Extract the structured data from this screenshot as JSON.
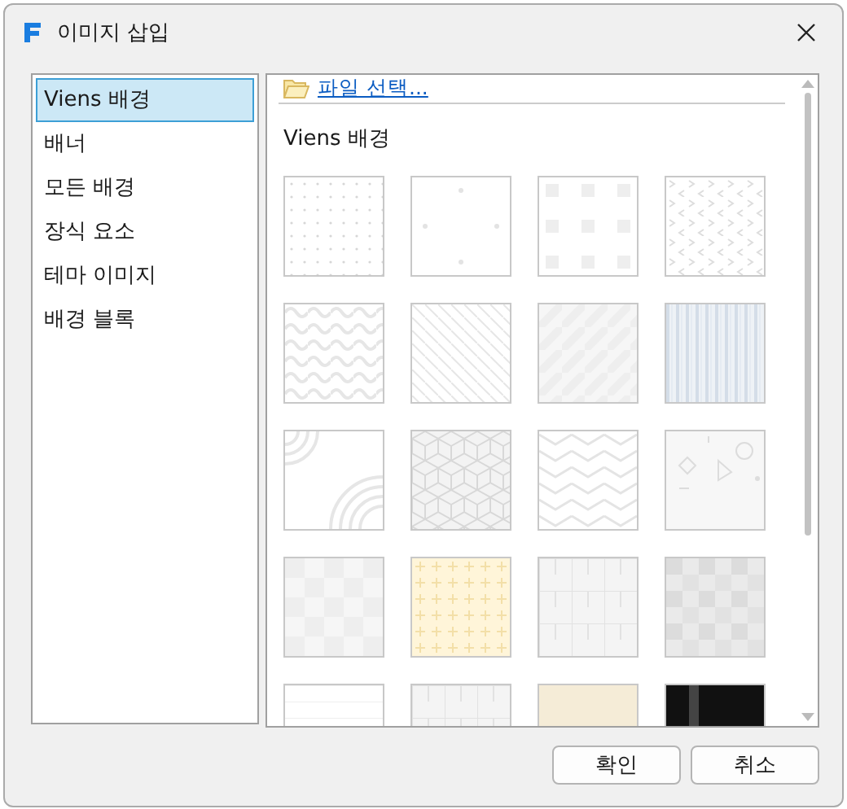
{
  "window": {
    "title": "이미지 삽입"
  },
  "categories": [
    {
      "label": "Viens 배경",
      "selected": true
    },
    {
      "label": "배너",
      "selected": false
    },
    {
      "label": "모든 배경",
      "selected": false
    },
    {
      "label": "장식 요소",
      "selected": false
    },
    {
      "label": "테마 이미지",
      "selected": false
    },
    {
      "label": "배경 블록",
      "selected": false
    }
  ],
  "file_link": "파일 선택...",
  "section_title": "Viens 배경",
  "thumbnails": [
    {
      "kind": "dots"
    },
    {
      "kind": "sparse-dots"
    },
    {
      "kind": "squares"
    },
    {
      "kind": "chevrons"
    },
    {
      "kind": "waves"
    },
    {
      "kind": "diagonal-lines"
    },
    {
      "kind": "wide-stripes"
    },
    {
      "kind": "vertical-stripes"
    },
    {
      "kind": "arcs"
    },
    {
      "kind": "cubes"
    },
    {
      "kind": "zigzag"
    },
    {
      "kind": "shapes"
    },
    {
      "kind": "checker"
    },
    {
      "kind": "crosses"
    },
    {
      "kind": "line-grid"
    },
    {
      "kind": "stone-checker"
    },
    {
      "kind": "plain"
    },
    {
      "kind": "line-grid"
    },
    {
      "kind": "cream"
    },
    {
      "kind": "dark"
    }
  ],
  "buttons": [
    "확인",
    "취소"
  ]
}
